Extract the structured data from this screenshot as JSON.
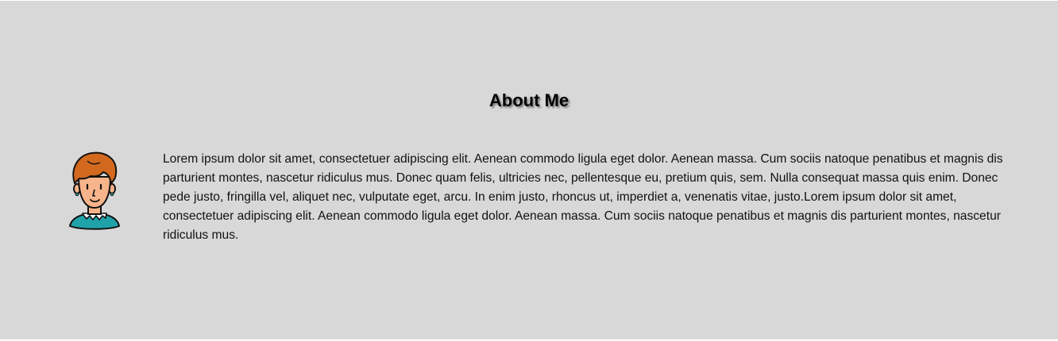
{
  "about": {
    "heading": "About Me",
    "bio": "Lorem ipsum dolor sit amet, consectetuer adipiscing elit. Aenean commodo ligula eget dolor. Aenean massa. Cum sociis natoque penatibus et magnis dis parturient montes, nascetur ridiculus mus. Donec quam felis, ultricies nec, pellentesque eu, pretium quis, sem. Nulla consequat massa quis enim. Donec pede justo, fringilla vel, aliquet nec, vulputate eget, arcu. In enim justo, rhoncus ut, imperdiet a, venenatis vitae, justo.Lorem ipsum dolor sit amet, consectetuer adipiscing elit. Aenean commodo ligula eget dolor. Aenean massa. Cum sociis natoque penatibus et magnis dis parturient montes, nascetur ridiculus mus.",
    "avatar_icon": "person-avatar-icon"
  },
  "colors": {
    "section_background": "#d8d8d8",
    "hair": "#d2691e",
    "skin": "#f7b48a",
    "shirt": "#1fa3a8"
  }
}
